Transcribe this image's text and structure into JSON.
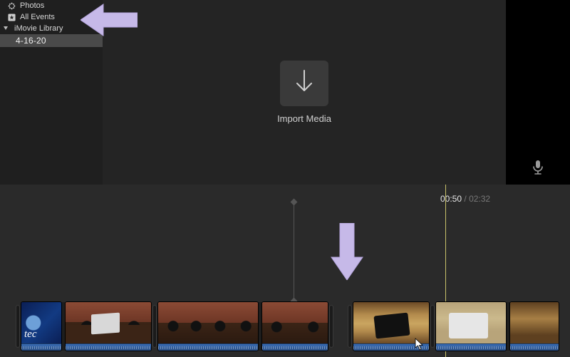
{
  "sidebar": {
    "items": [
      {
        "label": "Photos"
      },
      {
        "label": "All Events"
      },
      {
        "label": "iMovie Library"
      }
    ],
    "selected_event": "4-16-20"
  },
  "media_area": {
    "import_label": "Import Media"
  },
  "timeline": {
    "current_time": "00:50",
    "separator": "/",
    "total_time": "02:32"
  },
  "intro_clip_text": "tec"
}
